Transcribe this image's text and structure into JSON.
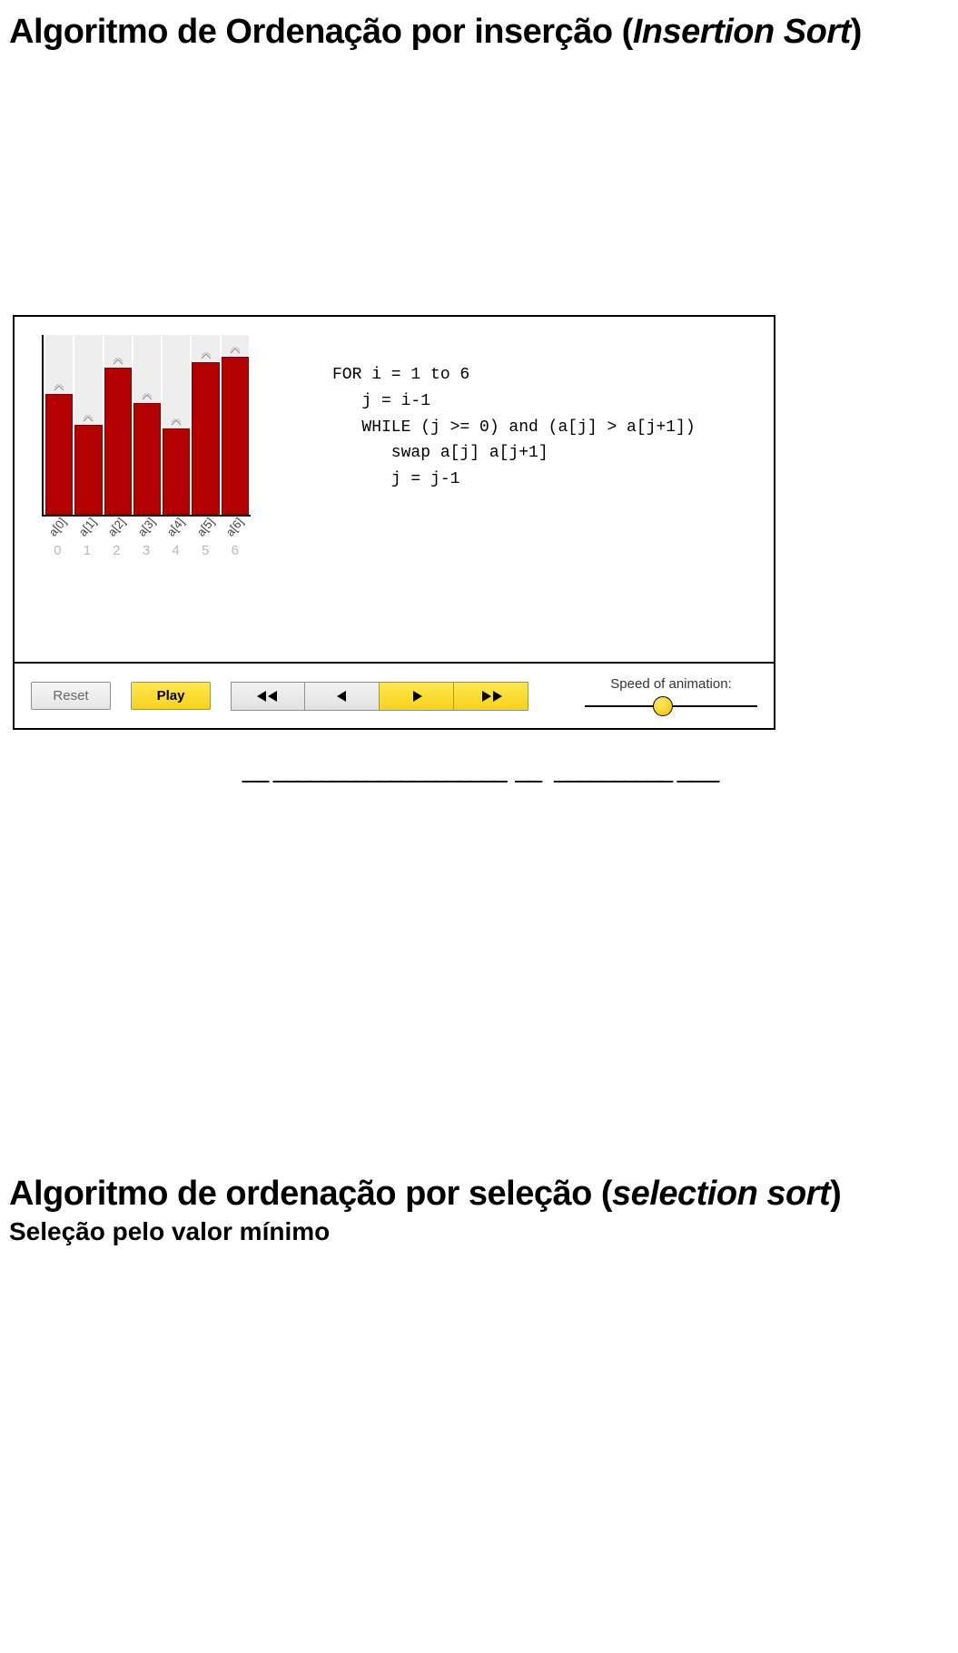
{
  "title1_plain": "Algoritmo de Ordenação por inserção (",
  "title1_ital": "Insertion Sort",
  "title1_close": ")",
  "chart_data": {
    "type": "bar",
    "categories": [
      "a[0]",
      "a[1]",
      "a[2]",
      "a[3]",
      "a[4]",
      "a[5]",
      "a[6]"
    ],
    "indices": [
      "0",
      "1",
      "2",
      "3",
      "4",
      "5",
      "6"
    ],
    "values": [
      67,
      50,
      82,
      62,
      48,
      85,
      88
    ],
    "ylim": [
      0,
      100
    ],
    "title": "",
    "xlabel": "",
    "ylabel": ""
  },
  "code_lines": [
    "FOR i = 1 to 6",
    "   j = i-1",
    "   WHILE (j >= 0) and (a[j] > a[j+1])",
    "      swap a[j] a[j+1]",
    "      j = j-1"
  ],
  "controls": {
    "reset": "Reset",
    "play": "Play",
    "speed_label": "Speed of animation:",
    "slider_pos_pct": 45
  },
  "caption_placeholder": "__  ____________________   __    __________  __ _",
  "title2_plain": "Algoritmo de ordenação por seleção (",
  "title2_ital": "selection sort",
  "title2_close": ")",
  "subtitle2": "Seleção pelo valor mínimo"
}
